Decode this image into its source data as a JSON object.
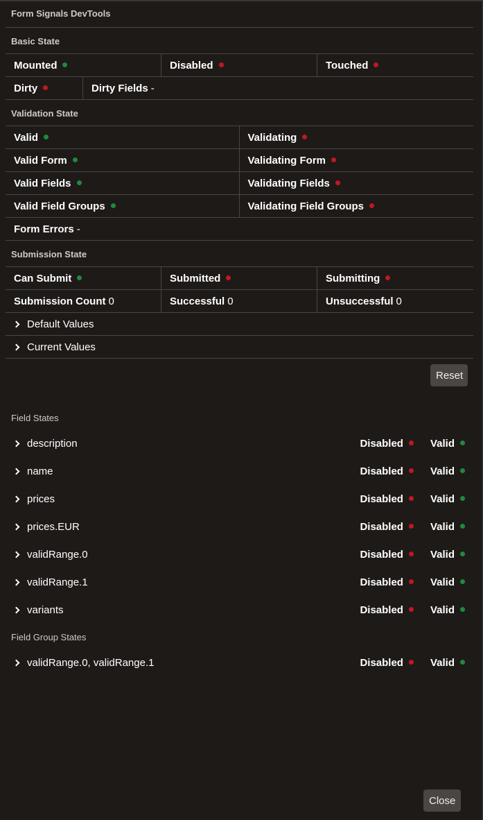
{
  "panel": {
    "title": "Form Signals DevTools"
  },
  "basic_state": {
    "title": "Basic State",
    "mounted": {
      "label": "Mounted",
      "state": true
    },
    "disabled": {
      "label": "Disabled",
      "state": false
    },
    "touched": {
      "label": "Touched",
      "state": false
    },
    "dirty": {
      "label": "Dirty",
      "state": false
    },
    "dirty_fields": {
      "label": "Dirty Fields",
      "value": "-"
    }
  },
  "validation_state": {
    "title": "Validation State",
    "rows": [
      {
        "left": {
          "label": "Valid",
          "state": true
        },
        "right": {
          "label": "Validating",
          "state": false
        }
      },
      {
        "left": {
          "label": "Valid Form",
          "state": true
        },
        "right": {
          "label": "Validating Form",
          "state": false
        }
      },
      {
        "left": {
          "label": "Valid Fields",
          "state": true
        },
        "right": {
          "label": "Validating Fields",
          "state": false
        }
      },
      {
        "left": {
          "label": "Valid Field Groups",
          "state": true
        },
        "right": {
          "label": "Validating Field Groups",
          "state": false
        }
      }
    ],
    "form_errors": {
      "label": "Form Errors",
      "value": "-"
    }
  },
  "submission_state": {
    "title": "Submission State",
    "can_submit": {
      "label": "Can Submit",
      "state": true
    },
    "submitted": {
      "label": "Submitted",
      "state": false
    },
    "submitting": {
      "label": "Submitting",
      "state": false
    },
    "submission_count": {
      "label": "Submission Count",
      "value": "0"
    },
    "successful": {
      "label": "Successful",
      "value": "0"
    },
    "unsuccessful": {
      "label": "Unsuccessful",
      "value": "0"
    }
  },
  "expanders": {
    "default_values": "Default Values",
    "current_values": "Current Values"
  },
  "buttons": {
    "reset": "Reset",
    "close": "Close"
  },
  "status_labels": {
    "disabled": "Disabled",
    "valid": "Valid"
  },
  "field_states": {
    "title": "Field States",
    "fields": [
      {
        "name": "description",
        "disabled": false,
        "valid": true
      },
      {
        "name": "name",
        "disabled": false,
        "valid": true
      },
      {
        "name": "prices",
        "disabled": false,
        "valid": true
      },
      {
        "name": "prices.EUR",
        "disabled": false,
        "valid": true
      },
      {
        "name": "validRange.0",
        "disabled": false,
        "valid": true
      },
      {
        "name": "validRange.1",
        "disabled": false,
        "valid": true
      },
      {
        "name": "variants",
        "disabled": false,
        "valid": true
      }
    ]
  },
  "field_group_states": {
    "title": "Field Group States",
    "groups": [
      {
        "name": "validRange.0, validRange.1",
        "disabled": false,
        "valid": true
      }
    ]
  },
  "colors": {
    "on": "#1e8a3e",
    "off": "#c0181f",
    "background": "#1e1a18",
    "border": "#4a4644",
    "button": "#4a4644"
  }
}
